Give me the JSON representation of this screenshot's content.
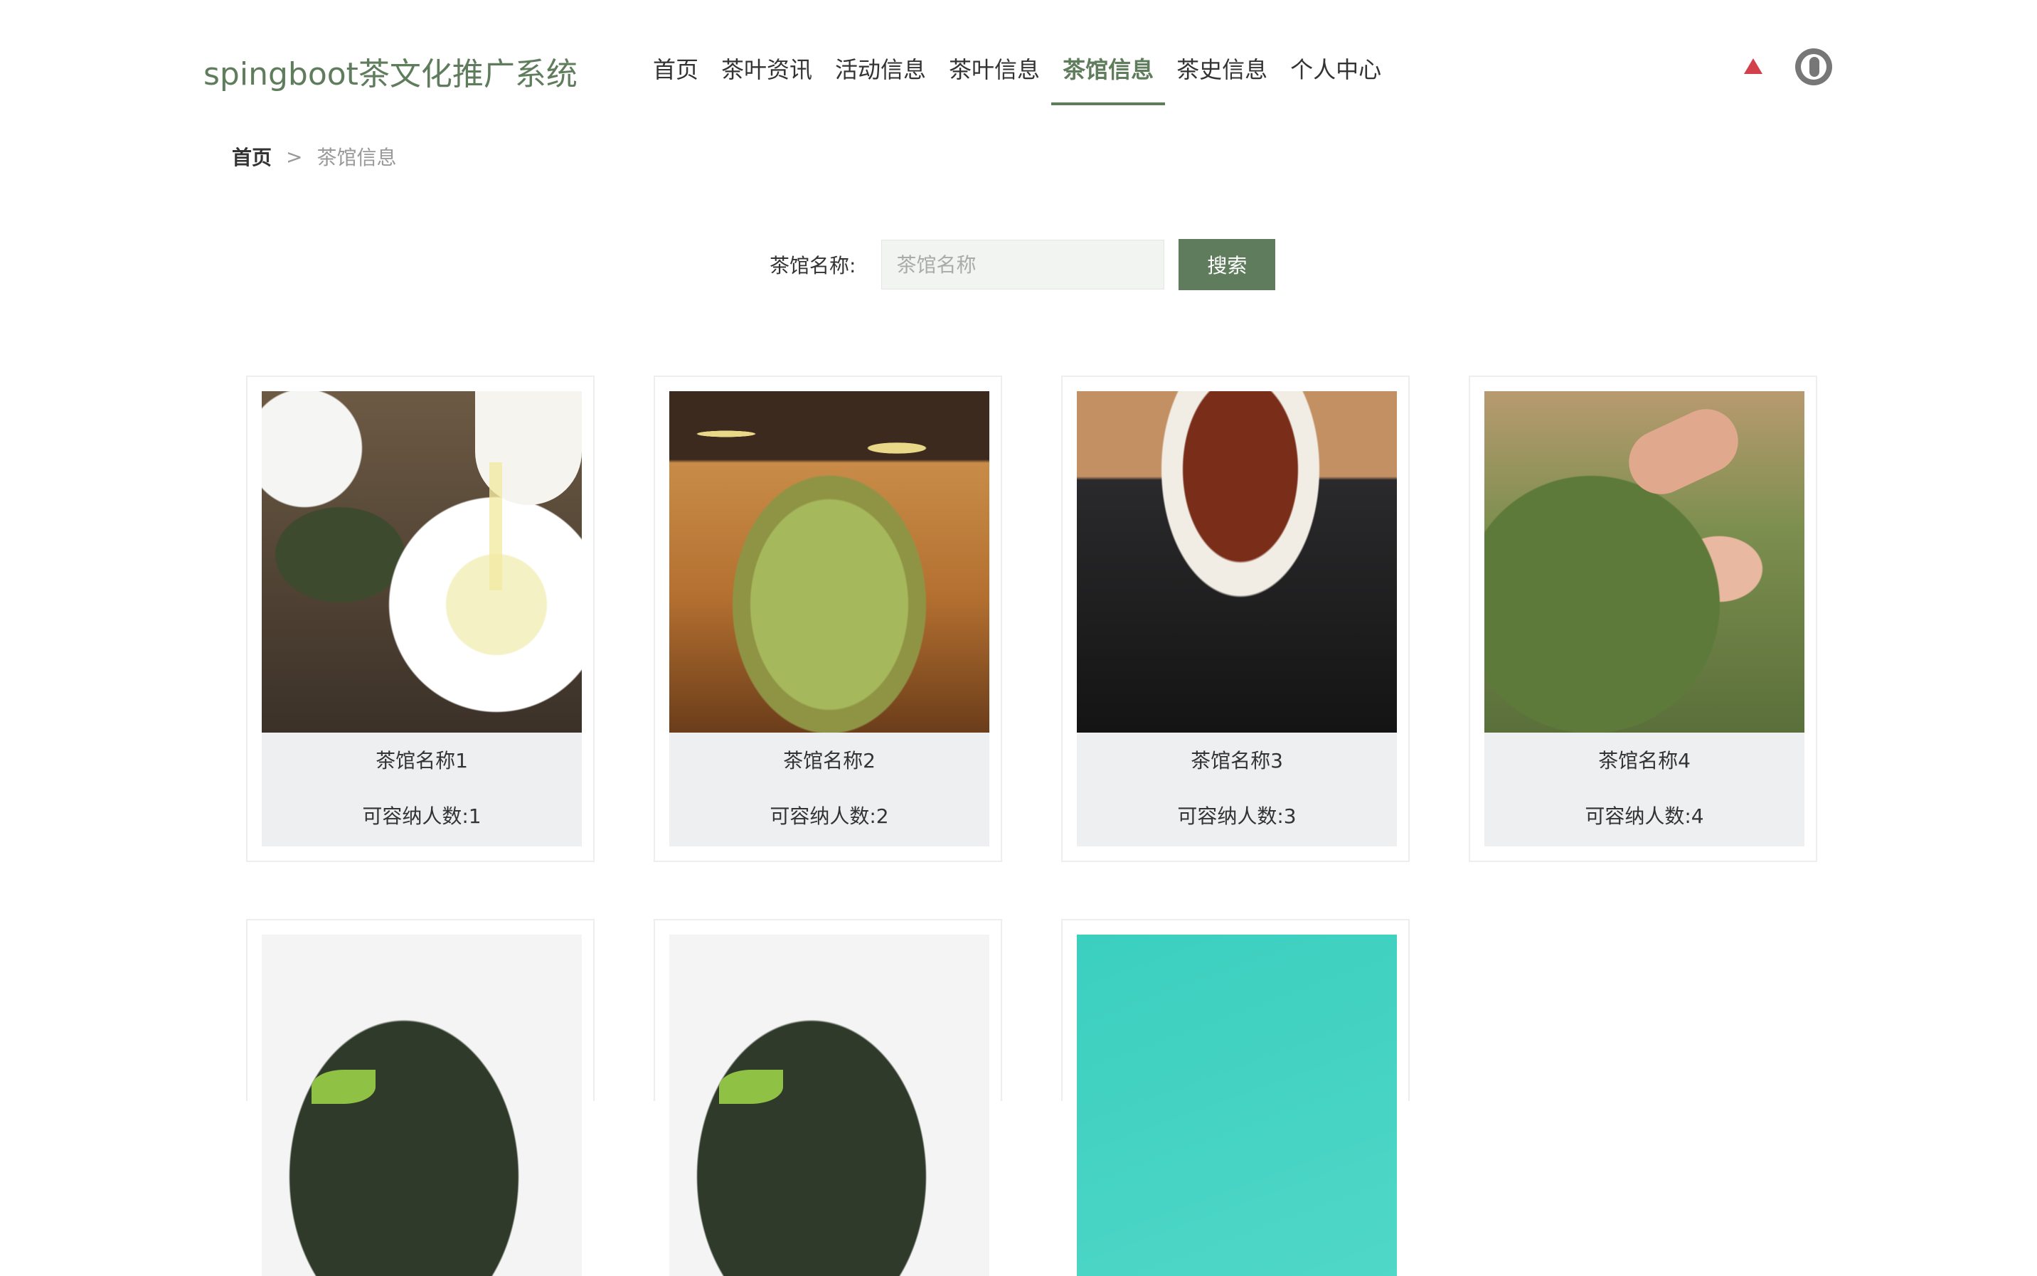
{
  "header": {
    "brand": "spingboot茶文化推广系统",
    "nav": [
      "首页",
      "茶叶资讯",
      "活动信息",
      "茶叶信息",
      "茶馆信息",
      "茶史信息",
      "个人中心"
    ],
    "active_nav": "茶馆信息"
  },
  "breadcrumb": {
    "home": "首页",
    "separator": ">",
    "current": "茶馆信息"
  },
  "search": {
    "label": "茶馆名称:",
    "placeholder": "茶馆名称",
    "value": "",
    "button": "搜索"
  },
  "cards": [
    {
      "name": "茶馆名称1",
      "capacity": "可容纳人数:1"
    },
    {
      "name": "茶馆名称2",
      "capacity": "可容纳人数:2"
    },
    {
      "name": "茶馆名称3",
      "capacity": "可容纳人数:3"
    },
    {
      "name": "茶馆名称4",
      "capacity": "可容纳人数:4"
    }
  ],
  "colors": {
    "brand": "#5f7d5c",
    "accent_icon": "#d2404b"
  },
  "icons": {
    "top_right": "up-arrow-icon",
    "user": "avatar"
  }
}
